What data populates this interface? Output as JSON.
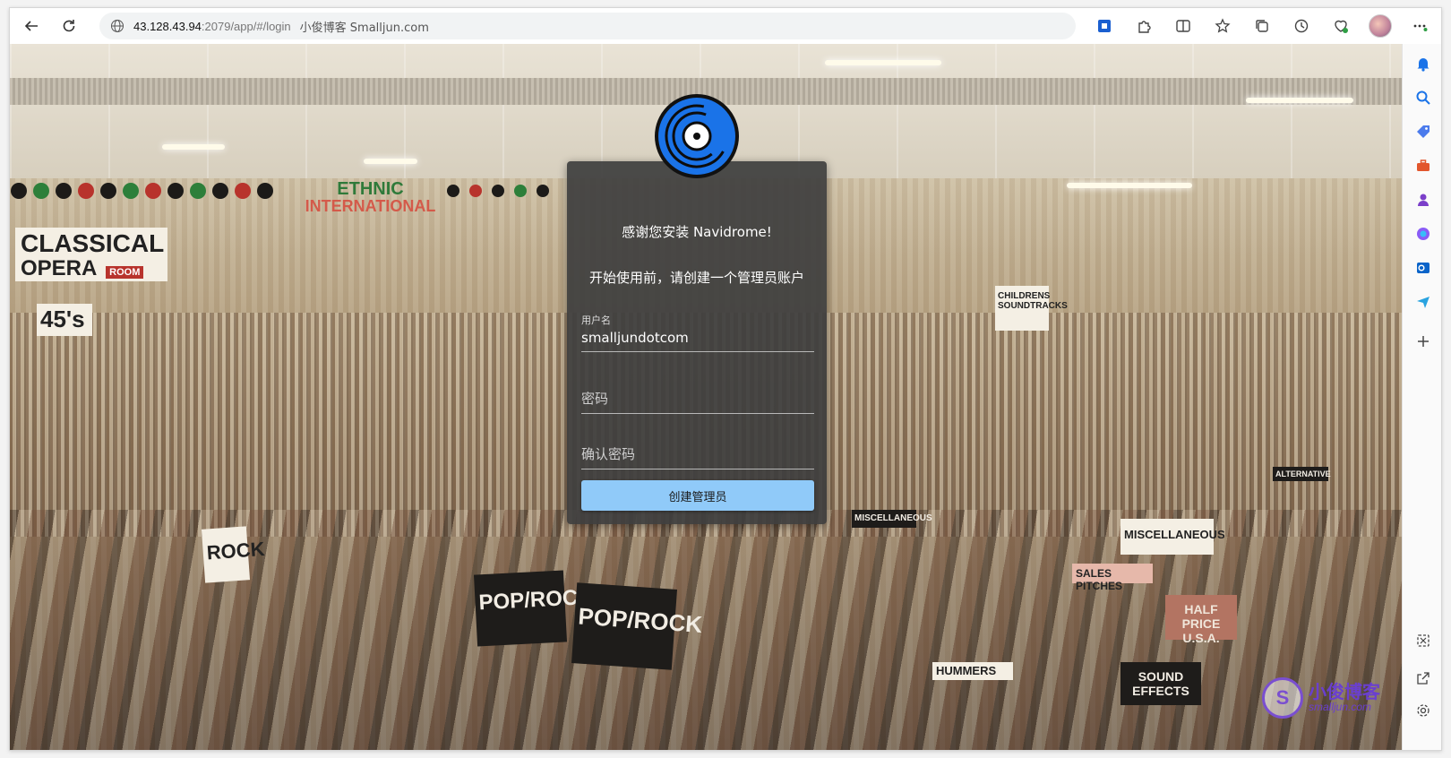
{
  "browser": {
    "url_host": "43.128.43.94",
    "url_path": ":2079/app/#/login",
    "page_title": "小俊博客 Smalljun.com"
  },
  "login": {
    "welcome": "感谢您安装 Navidrome!",
    "subtitle": "开始使用前，请创建一个管理员账户",
    "username_label": "用户名",
    "username_value": "smalljundotcom",
    "password_placeholder": "密码",
    "confirm_placeholder": "确认密码",
    "create_button": "创建管理员"
  },
  "background_signs": {
    "classical": "CLASSICAL",
    "opera": "OPERA",
    "room": "ROOM",
    "ethnic": "ETHNIC",
    "international": "INTERNATIONAL",
    "s45": "45's",
    "rock": "ROCK",
    "poprock1": "POP/ROCK",
    "poprock2": "POP/ROCK",
    "misc1": "MISCELLANEOUS",
    "misc2": "MISCELLANEOUS",
    "sound_effects": "SOUND EFFECTS",
    "children": "CHILDRENS SOUNDTRACKS",
    "alternative": "ALTERNATIVE",
    "sales_pitches": "SALES PITCHES",
    "half_price": "HALF PRICE U.S.A.",
    "hummers": "HUMMERS"
  },
  "watermark": {
    "cn": "小俊博客",
    "en": "smalljun.com",
    "badge": "S"
  },
  "colors": {
    "accent": "#90caf9",
    "card_bg": "#3e3e3e",
    "logo_blue": "#1a73e8"
  }
}
